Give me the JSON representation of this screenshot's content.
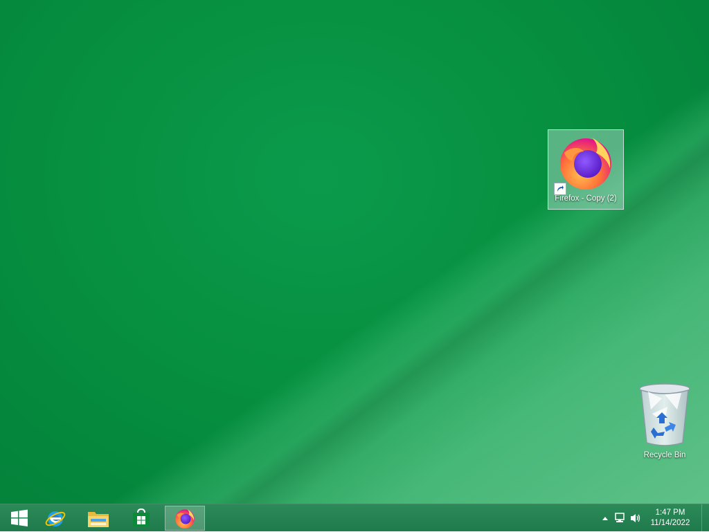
{
  "desktop": {
    "icons": [
      {
        "label": "Firefox - Copy (2)",
        "icon": "firefox-icon",
        "shortcut": true,
        "selected": true
      },
      {
        "label": "Recycle Bin",
        "icon": "recycle-bin-icon",
        "shortcut": false,
        "selected": false
      }
    ]
  },
  "taskbar": {
    "start": {
      "icon": "windows-logo-icon"
    },
    "pinned": [
      {
        "name": "Internet Explorer",
        "icon": "internet-explorer-icon"
      },
      {
        "name": "File Explorer",
        "icon": "file-explorer-icon"
      },
      {
        "name": "Store",
        "icon": "store-icon"
      },
      {
        "name": "Firefox",
        "icon": "firefox-icon",
        "active": true
      }
    ],
    "tray": {
      "icons": [
        "chevron-up-icon",
        "network-icon",
        "volume-icon"
      ],
      "time": "1:47 PM",
      "date": "11/14/2022"
    }
  },
  "colors": {
    "desktop_bg": "#06903f",
    "taskbar_bg": "#1f7a4c"
  }
}
